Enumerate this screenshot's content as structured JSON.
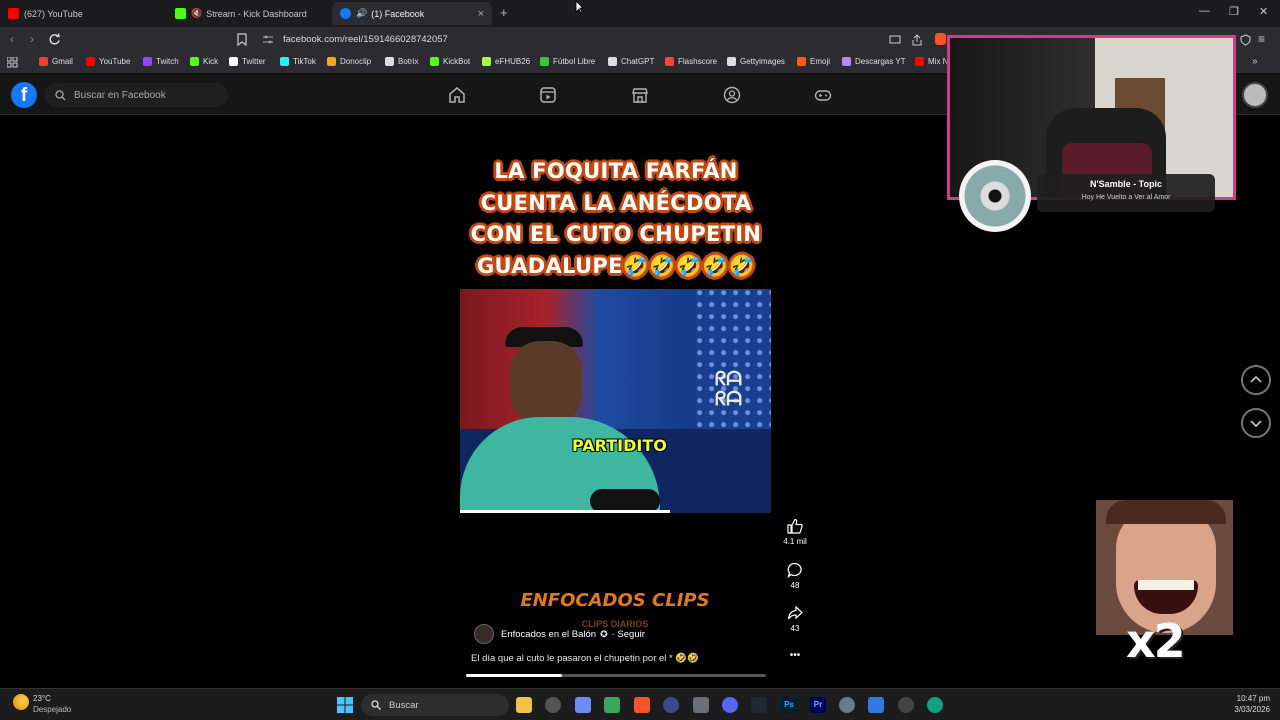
{
  "browser": {
    "tabs": [
      {
        "title": "(627) YouTube",
        "favicon_color": "#ff0000"
      },
      {
        "title": "Stream - Kick Dashboard",
        "favicon_color": "#53fc18"
      },
      {
        "title": "(1) Facebook",
        "favicon_color": "#1877f2",
        "active": true
      }
    ],
    "new_tab": "+",
    "close_tab": "×",
    "url": "facebook.com/reel/1591466028742057",
    "window_controls": [
      "—",
      "❐",
      "✕"
    ]
  },
  "bookmarks": [
    {
      "label": "Gmail",
      "color": "#ea4335"
    },
    {
      "label": "YouTube",
      "color": "#ff0000"
    },
    {
      "label": "Twitch",
      "color": "#9146ff"
    },
    {
      "label": "Kick",
      "color": "#53fc18"
    },
    {
      "label": "Twitter",
      "color": "#ffffff"
    },
    {
      "label": "TikTok",
      "color": "#25f4ee"
    },
    {
      "label": "Donoclip",
      "color": "#f5a623"
    },
    {
      "label": "Botrix",
      "color": "#dddddd"
    },
    {
      "label": "KickBot",
      "color": "#53fc18"
    },
    {
      "label": "eFHUB26",
      "color": "#a0ff40"
    },
    {
      "label": "Fútbol Libre",
      "color": "#3ec43e"
    },
    {
      "label": "ChatGPT",
      "color": "#dddddd"
    },
    {
      "label": "Flashscore",
      "color": "#ff4040"
    },
    {
      "label": "Gettyimages",
      "color": "#dddddd"
    },
    {
      "label": "Emoji",
      "color": "#ff5a1f"
    },
    {
      "label": "Descargas YT",
      "color": "#b388ff"
    },
    {
      "label": "Mix N",
      "color": "#ff0000"
    }
  ],
  "facebook": {
    "logo": "f",
    "search_placeholder": "Buscar en Facebook",
    "nav_icons": [
      "home-icon",
      "reels-icon",
      "marketplace-icon",
      "groups-icon",
      "gaming-icon"
    ]
  },
  "reel": {
    "title_lines": [
      "LA FOQUITA FARFÁN",
      "CUENTA LA ANÉCDOTA",
      "CON EL CUTO CHUPETIN",
      "GUADALUPE🤣🤣🤣🤣🤣"
    ],
    "caption": "PARTIDITO",
    "brand": "ENFOCADOS CLIPS",
    "brand_sub": "CLIPS DIARIOS",
    "author": "Enfocados en el Balón",
    "follow": "· Seguir",
    "description": "El día que al cuto le pasaron el chupetin por el * 🤣🤣",
    "progress": 0.32,
    "likes": "4.1 mil",
    "comments": "48",
    "shares": "43",
    "more": "•••"
  },
  "overlay": {
    "music_artist": "N'Samble - Topic",
    "music_song": "Hoy He Vuelto a Ver al Amor",
    "emote_text": "x2"
  },
  "taskbar": {
    "weather_temp": "23°C",
    "weather_desc": "Despejado",
    "search": "Buscar",
    "time": "10:47 pm",
    "date": "3/03/2026"
  }
}
